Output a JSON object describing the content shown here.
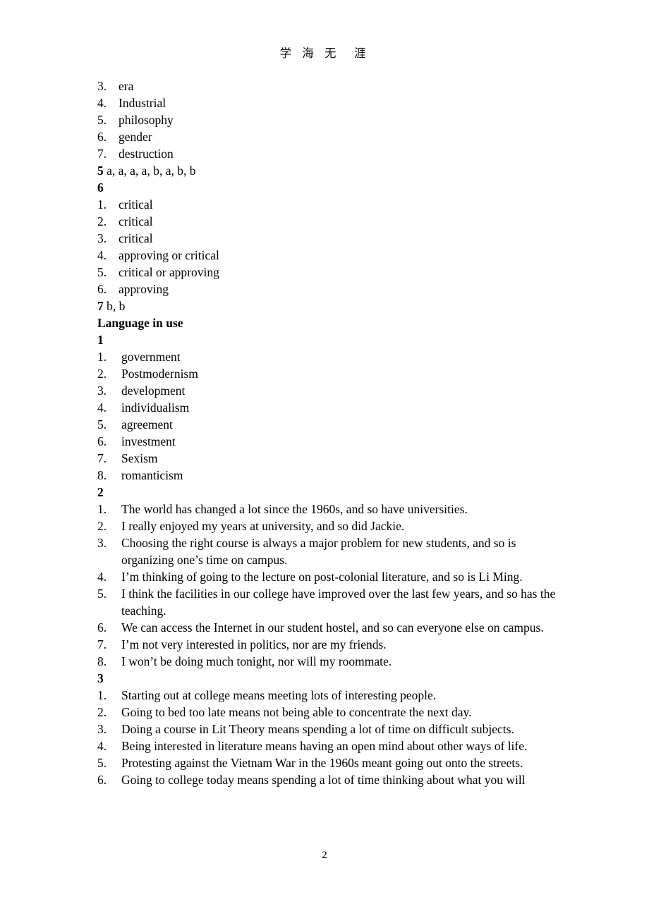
{
  "header": {
    "title": "学 海 无  涯"
  },
  "page_number": "2",
  "blocks": {
    "vocab_list_top": {
      "items": [
        {
          "num": "3.",
          "text": "era"
        },
        {
          "num": "4.",
          "text": "Industrial"
        },
        {
          "num": "5.",
          "text": "philosophy"
        },
        {
          "num": "6.",
          "text": "gender"
        },
        {
          "num": "7.",
          "text": "destruction"
        }
      ]
    },
    "answer_5": {
      "label": "5",
      "answers": " a, a, a, a, b, a, b, b"
    },
    "answer_6": {
      "label": "6",
      "items": [
        {
          "num": "1.",
          "text": "critical"
        },
        {
          "num": "2.",
          "text": "critical"
        },
        {
          "num": "3.",
          "text": "critical"
        },
        {
          "num": "4.",
          "text": "approving or critical"
        },
        {
          "num": "5.",
          "text": "critical or approving"
        },
        {
          "num": "6.",
          "text": "approving"
        }
      ]
    },
    "answer_7": {
      "label": "7",
      "answers": " b, b"
    },
    "language_in_use": {
      "heading": "Language in use",
      "section_1": {
        "label": "1",
        "items": [
          {
            "num": "1.",
            "text": "government"
          },
          {
            "num": "2.",
            "text": "Postmodernism"
          },
          {
            "num": "3.",
            "text": "development"
          },
          {
            "num": "4.",
            "text": "individualism"
          },
          {
            "num": "5.",
            "text": "agreement"
          },
          {
            "num": "6.",
            "text": "investment"
          },
          {
            "num": "7.",
            "text": "Sexism"
          },
          {
            "num": "8.",
            "text": "romanticism"
          }
        ]
      },
      "section_2": {
        "label": "2",
        "items": [
          {
            "num": "1.",
            "text": "The world has changed a lot since the 1960s, and so have universities."
          },
          {
            "num": "2.",
            "text": "I really enjoyed my years at university, and so did Jackie."
          },
          {
            "num": "3.",
            "text": "Choosing the right course is always a major problem for new students, and so is organizing one’s time on campus."
          },
          {
            "num": "4.",
            "text": "I’m thinking of going to the lecture on post-colonial literature, and so is Li Ming."
          },
          {
            "num": "5.",
            "text": "I think the facilities in our college have improved over the last few years, and so has the teaching."
          },
          {
            "num": "6.",
            "text": "We can access the Internet in our student hostel, and so can everyone else on campus."
          },
          {
            "num": "7.",
            "text": "I’m not very interested in politics, nor are my friends."
          },
          {
            "num": "8.",
            "text": "I won’t be doing much tonight, nor will my roommate."
          }
        ]
      },
      "section_3": {
        "label": "3",
        "items": [
          {
            "num": "1.",
            "text": "Starting out at college means meeting lots of interesting people."
          },
          {
            "num": "2.",
            "text": "Going to bed too late means not being able to concentrate the next day."
          },
          {
            "num": "3.",
            "text": "Doing a course in Lit Theory means spending a lot of time on difficult subjects."
          },
          {
            "num": "4.",
            "text": "Being interested in literature means having an open mind about other ways of life."
          },
          {
            "num": "5.",
            "text": "Protesting against the Vietnam War in the 1960s meant going out onto the streets."
          },
          {
            "num": "6.",
            "text": "Going to college today means spending a lot of time thinking about what you  will"
          }
        ]
      }
    }
  }
}
